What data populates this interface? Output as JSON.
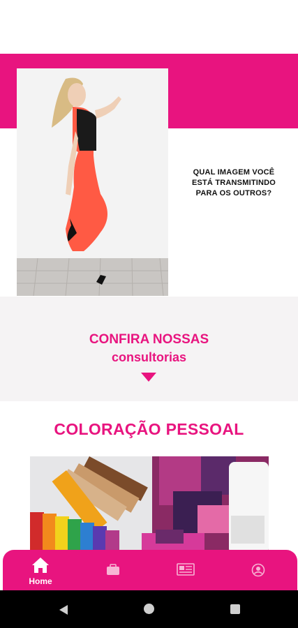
{
  "colors": {
    "brand_pink": "#e8147f",
    "section_bg": "#f5f3f4",
    "system_bar": "#000000"
  },
  "hero": {
    "caption": "QUAL IMAGEM VOCÊ ESTÁ TRANSMITINDO PARA OS OUTROS?",
    "photo_icon": "woman-in-coral-skirt-photo"
  },
  "consult": {
    "title": "CONFIRA NOSSAS",
    "subtitle": "consultorias",
    "arrow_icon": "triangle-down-icon"
  },
  "coloracao": {
    "title": "COLORAÇÃO PESSOAL",
    "photo_icon": "color-swatch-fan-photo"
  },
  "bottom_nav": {
    "items": [
      {
        "label": "Home",
        "icon": "home-icon",
        "active": true
      },
      {
        "label": "",
        "icon": "briefcase-icon",
        "active": false
      },
      {
        "label": "",
        "icon": "newspaper-icon",
        "active": false
      },
      {
        "label": "",
        "icon": "account-circle-icon",
        "active": false
      }
    ]
  },
  "system_nav": {
    "back_icon": "back-triangle-icon",
    "home_icon": "home-circle-icon",
    "recent_icon": "recent-square-icon"
  }
}
